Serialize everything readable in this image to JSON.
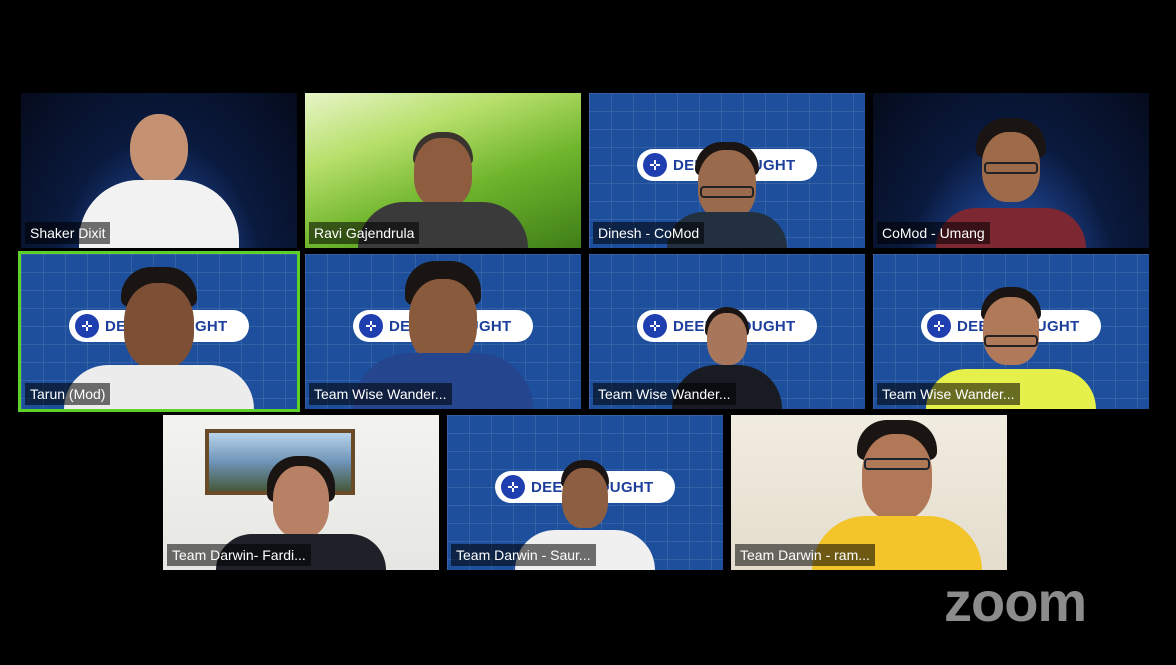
{
  "brand": {
    "text": "DEEP THOUGHT",
    "accent": "#1f3fb0"
  },
  "participants": [
    {
      "name": "Shaker Dixit"
    },
    {
      "name": "Ravi Gajendrula"
    },
    {
      "name": "Dinesh - CoMod"
    },
    {
      "name": "CoMod - Umang"
    },
    {
      "name": "Tarun (Mod)"
    },
    {
      "name": "Team Wise Wander..."
    },
    {
      "name": "Team Wise Wander..."
    },
    {
      "name": "Team Wise Wander..."
    },
    {
      "name": "Team Darwin- Fardi..."
    },
    {
      "name": "Team Darwin - Saur..."
    },
    {
      "name": "Team Darwin - ram..."
    }
  ],
  "active_speaker_color": "#5bd12a",
  "app_logo": "zoom"
}
